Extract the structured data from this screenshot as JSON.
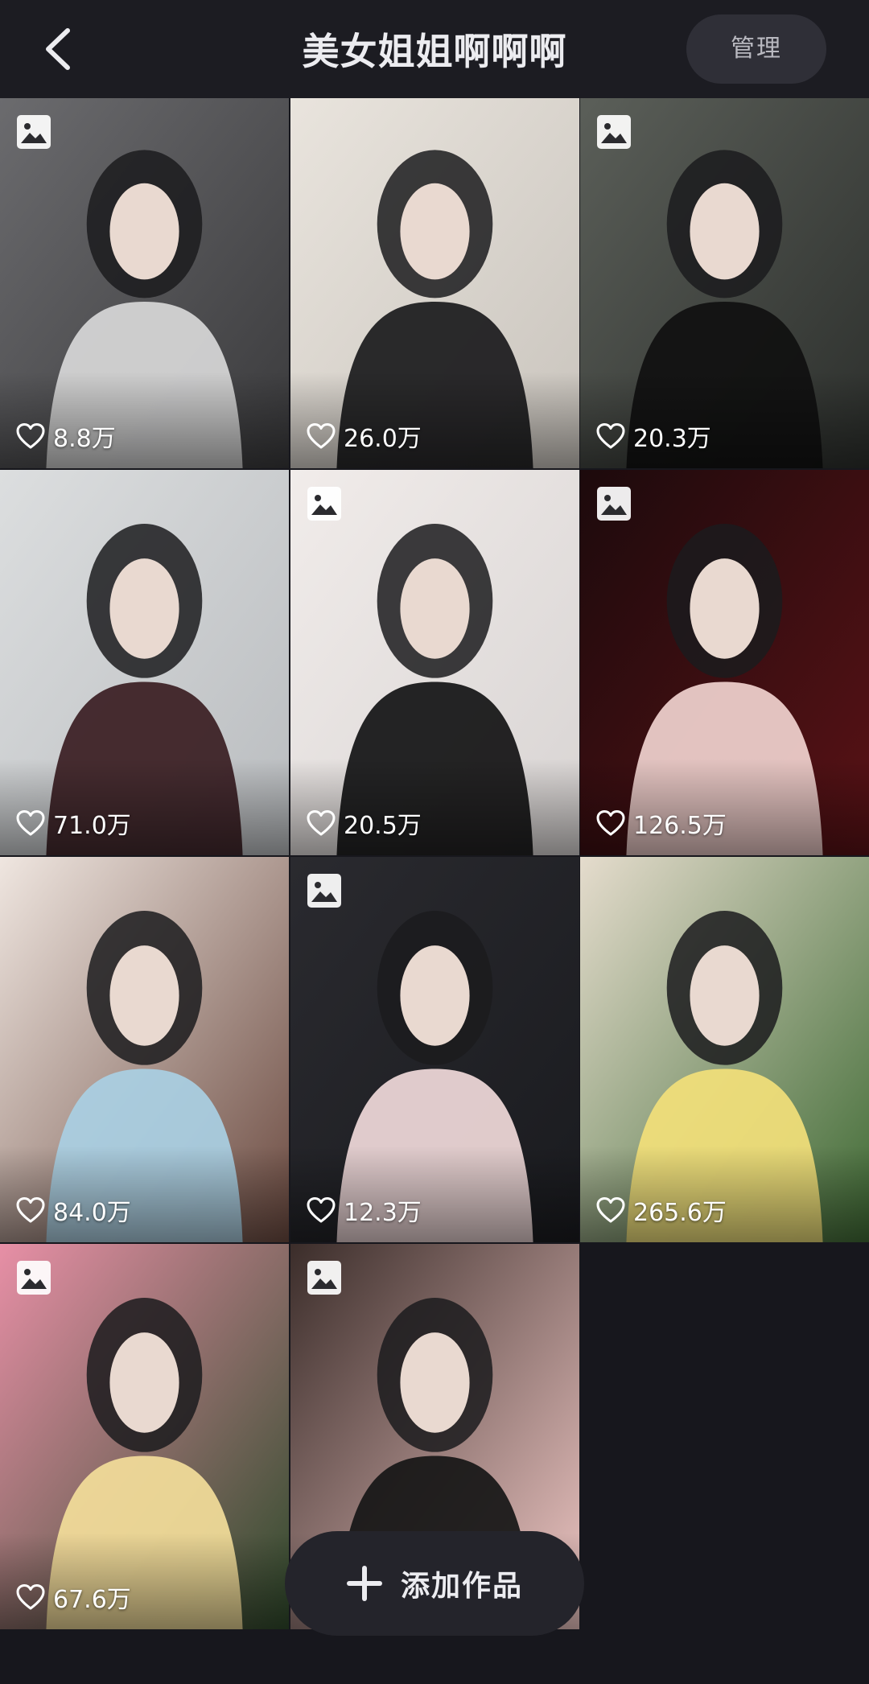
{
  "header": {
    "title": "美女姐姐啊啊啊",
    "manage_label": "管理"
  },
  "works": [
    {
      "likes": "8.8万",
      "image_post": true,
      "palette": [
        "#3a3a3c",
        "#d8d8d8",
        "#6b6b6e"
      ]
    },
    {
      "likes": "26.0万",
      "image_post": false,
      "palette": [
        "#c9c4bd",
        "#1a1a1c",
        "#e9e4dd"
      ]
    },
    {
      "likes": "20.3万",
      "image_post": true,
      "palette": [
        "#2c2f2c",
        "#101010",
        "#5b5f59"
      ]
    },
    {
      "likes": "71.0万",
      "image_post": false,
      "palette": [
        "#b9bcbf",
        "#3a1d22",
        "#dcdedf"
      ]
    },
    {
      "likes": "20.5万",
      "image_post": true,
      "palette": [
        "#d8d4d3",
        "#121214",
        "#f1ecea"
      ]
    },
    {
      "likes": "126.5万",
      "image_post": true,
      "palette": [
        "#5a1216",
        "#f1d3cf",
        "#1c0a0c"
      ]
    },
    {
      "likes": "84.0万",
      "image_post": false,
      "palette": [
        "#6b4a40",
        "#a9cfe3",
        "#efe6e0"
      ]
    },
    {
      "likes": "12.3万",
      "image_post": true,
      "palette": [
        "#1a1b1f",
        "#f1dada",
        "#2a2a2f"
      ]
    },
    {
      "likes": "265.6万",
      "image_post": false,
      "palette": [
        "#3f6a34",
        "#f2e07a",
        "#e5dccd"
      ]
    },
    {
      "likes": "67.6万",
      "image_post": true,
      "palette": [
        "#2f4a2b",
        "#f3dd9a",
        "#e78fa6"
      ]
    },
    {
      "likes": "",
      "image_post": true,
      "palette": [
        "#efc7c4",
        "#161616",
        "#3b2d2a"
      ]
    }
  ],
  "add_button": {
    "label": "添加作品"
  },
  "icons": {
    "back": "chevron-left-icon",
    "image_badge": "image-icon",
    "like": "heart-outline-icon",
    "add": "plus-icon"
  }
}
